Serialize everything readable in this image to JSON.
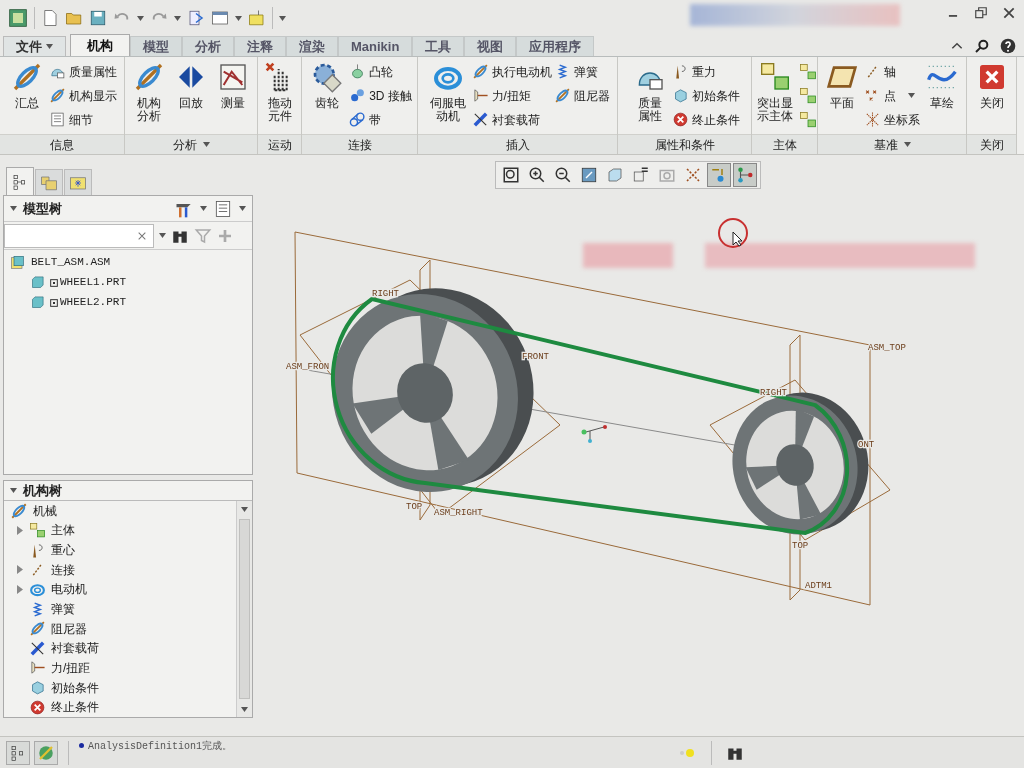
{
  "menu_tabs": [
    {
      "label": "文件",
      "kind": "menu",
      "selected": false
    },
    {
      "label": "机构",
      "kind": "tab",
      "selected": true
    },
    {
      "label": "模型",
      "kind": "tab",
      "selected": false
    },
    {
      "label": "分析",
      "kind": "tab",
      "selected": false
    },
    {
      "label": "注释",
      "kind": "tab",
      "selected": false
    },
    {
      "label": "渲染",
      "kind": "tab",
      "selected": false
    },
    {
      "label": "Manikin",
      "kind": "tab",
      "selected": false
    },
    {
      "label": "工具",
      "kind": "tab",
      "selected": false
    },
    {
      "label": "视图",
      "kind": "tab",
      "selected": false
    },
    {
      "label": "应用程序",
      "kind": "tab",
      "selected": false
    }
  ],
  "ribbon_groups": [
    {
      "label": "信息",
      "has_menu": false,
      "large": [
        {
          "label": "汇总"
        }
      ],
      "small": [
        {
          "label": "质量属性"
        },
        {
          "label": "机构显示"
        },
        {
          "label": "细节"
        }
      ]
    },
    {
      "label": "分析",
      "has_menu": true,
      "large": [
        {
          "label": "机构分析"
        },
        {
          "label": "回放"
        },
        {
          "label": "测量"
        }
      ]
    },
    {
      "label": "运动",
      "has_menu": false,
      "large": [
        {
          "label": "拖动元件"
        }
      ]
    },
    {
      "label": "连接",
      "has_menu": false,
      "large": [
        {
          "label": "齿轮"
        }
      ],
      "small": [
        {
          "label": "凸轮"
        },
        {
          "label": "3D 接触"
        },
        {
          "label": "带"
        }
      ]
    },
    {
      "label": "插入",
      "has_menu": false,
      "large": [
        {
          "label": "伺服电动机"
        }
      ],
      "small": [
        {
          "label": "执行电动机"
        },
        {
          "label": "力/扭矩"
        },
        {
          "label": "衬套载荷"
        },
        {
          "label": "弹簧"
        },
        {
          "label": "阻尼器"
        }
      ]
    },
    {
      "label": "属性和条件",
      "has_menu": false,
      "large": [
        {
          "label": "质量属性"
        }
      ],
      "small": [
        {
          "label": "重力"
        },
        {
          "label": "初始条件"
        },
        {
          "label": "终止条件"
        }
      ]
    },
    {
      "label": "主体",
      "has_menu": false,
      "large": [
        {
          "label": "突出显示主体"
        }
      ]
    },
    {
      "label": "基准",
      "has_menu": true,
      "large": [
        {
          "label": "平面"
        }
      ],
      "small": [
        {
          "label": "轴"
        },
        {
          "label": "点"
        },
        {
          "label": "坐标系"
        }
      ],
      "large_after": [
        {
          "label": "草绘"
        }
      ]
    },
    {
      "label": "关闭",
      "has_menu": false,
      "large": [
        {
          "label": "关闭"
        }
      ]
    }
  ],
  "model_tree": {
    "title": "模型树",
    "items": [
      {
        "label": "BELT_ASM.ASM",
        "children": [
          {
            "label": "WHEEL1.PRT"
          },
          {
            "label": "WHEEL2.PRT"
          }
        ]
      }
    ]
  },
  "mechanism_tree": {
    "title": "机构树",
    "items": [
      {
        "label": "机械",
        "children": [
          {
            "label": "主体",
            "expandable": true
          },
          {
            "label": "重心",
            "expandable": false
          },
          {
            "label": "连接",
            "expandable": true
          },
          {
            "label": "电动机",
            "expandable": true
          },
          {
            "label": "弹簧",
            "expandable": false
          },
          {
            "label": "阻尼器",
            "expandable": false
          },
          {
            "label": "衬套载荷",
            "expandable": false
          },
          {
            "label": "力/扭距",
            "expandable": false
          },
          {
            "label": "初始条件",
            "expandable": false
          },
          {
            "label": "终止条件",
            "expandable": false
          }
        ]
      }
    ]
  },
  "view_toolbar": [
    {
      "selected": false
    },
    {
      "selected": false
    },
    {
      "selected": false
    },
    {
      "selected": false
    },
    {
      "selected": false
    },
    {
      "selected": false
    },
    {
      "selected": false
    },
    {
      "selected": false
    },
    {
      "selected": true
    },
    {
      "selected": true
    }
  ],
  "viewport_labels": [
    {
      "label": "RIGHT"
    },
    {
      "label": "ASM_FRON"
    },
    {
      "label": "FRONT"
    },
    {
      "label": "ASM_TOP"
    },
    {
      "label": "RIGHT"
    },
    {
      "label": "ONT"
    },
    {
      "label": "TOP"
    },
    {
      "label": "ASM_RIGHT"
    },
    {
      "label": "TOP"
    },
    {
      "label": "ADTM1"
    }
  ],
  "status_bar": {
    "message": "AnalysisDefinition1完成。"
  }
}
